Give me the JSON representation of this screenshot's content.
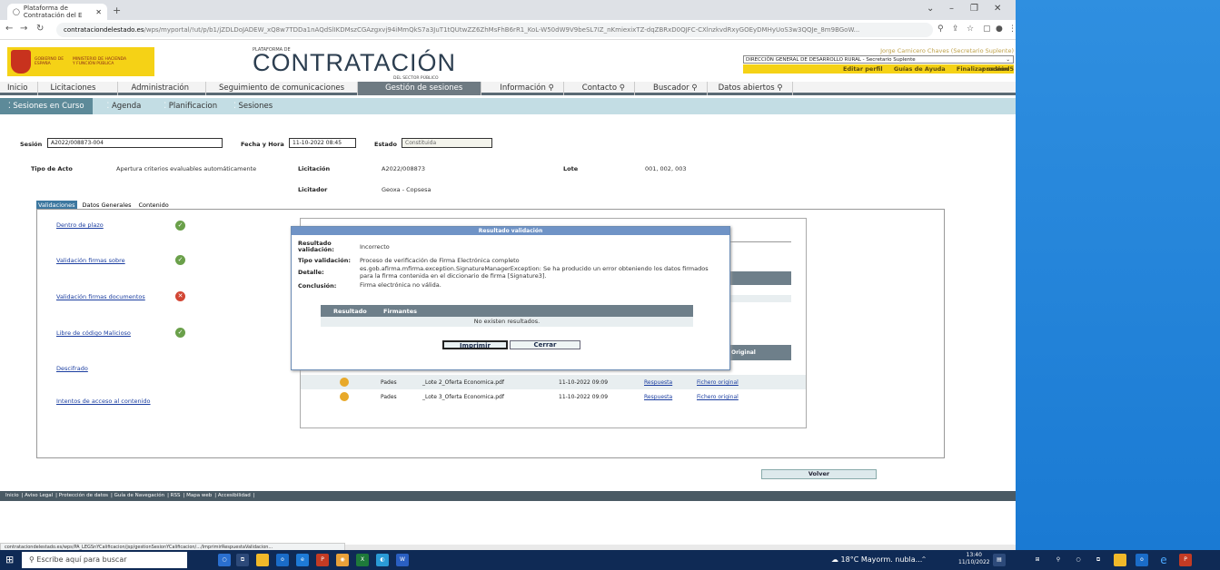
{
  "browser": {
    "tab_title": "Plataforma de Contratación del E",
    "url_host": "contrataciondelestado.es",
    "url_path": "/wps/myportal/!ut/p/b1/jZDLDoJADEW_xQ8w7TDDa1nAQdSlIKDMszCGAzgxvj94iMmQkS7a3JuT1tQUtwZZ6ZhMsFhB6rR1_KoL-W50dW9V9beSL7IZ_nKmiexixTZ-dqZBRxD0QJFC-CXlnzkvdRxyGOEyDMHyUoS3w3QQJe_8m9BGoW..."
  },
  "site": {
    "gov_lines": [
      "GOBIERNO DE ESPAÑA",
      "MINISTERIO DE HACIENDA Y FUNCIÓN PÚBLICA"
    ],
    "brand_top": "PLATAFORMA DE",
    "brand_main": "CONTRATACIÓN",
    "brand_sub": "DEL SECTOR PÚBLICO",
    "user_name": "Jorge Carnicero Chaves (Secretario Suplente)",
    "user_dir": "DIRECCIÓN GENERAL DE DESARROLLO RURAL - Secretario Suplente",
    "links": [
      "Editar perfil",
      "Guías de Ayuda",
      "Finalizar sesión"
    ],
    "env": "prodnod5"
  },
  "nav": [
    "Inicio",
    "Licitaciones",
    "Administración",
    "Seguimiento de comunicaciones",
    "Gestión de sesiones",
    "Información",
    "Contacto",
    "Buscador",
    "Datos abiertos"
  ],
  "subnav": [
    "Sesiones en Curso",
    "Agenda",
    "Planificacion",
    "Sesiones"
  ],
  "session": {
    "sesion_label": "Sesión",
    "sesion_val": "A2022/008873-004",
    "fecha_label": "Fecha y Hora",
    "fecha_val": "11-10-2022 08:45",
    "estado_label": "Estado",
    "estado_val": "Constituida",
    "acto_label": "Tipo de Acto",
    "acto_val": "Apertura criterios evaluables automáticamente",
    "licitacion_label": "Licitación",
    "licitacion_val": "A2022/008873",
    "lote_label": "Lote",
    "lote_val": "001, 002, 003",
    "licitador_label": "Licitador",
    "licitador_val": "Geoxa - Copsesa"
  },
  "tabs": [
    "Validaciones",
    "Datos Generales",
    "Contenido"
  ],
  "validations": [
    {
      "label": "Dentro de plazo",
      "status": "ok"
    },
    {
      "label": "Validación firmas sobre",
      "status": "ok"
    },
    {
      "label": "Validación firmas documentos",
      "status": "error"
    },
    {
      "label": "Libre de código Malicioso",
      "status": "ok"
    },
    {
      "label": "Descifrado",
      "status": "none"
    },
    {
      "label": "Intentos de acceso al contenido",
      "status": "none"
    }
  ],
  "inner": {
    "col_original": "Original",
    "rows": [
      {
        "tipo": "Pades",
        "fichero": "_Lote 2_Oferta Economica.pdf",
        "fecha": "11-10-2022 09:09",
        "resp": "Respuesta",
        "orig": "Fichero original"
      },
      {
        "tipo": "Pades",
        "fichero": "_Lote 3_Oferta Economica.pdf",
        "fecha": "11-10-2022 09:09",
        "resp": "Respuesta",
        "orig": "Fichero original"
      }
    ]
  },
  "modal": {
    "title": "Resultado validación",
    "resultado_label": "Resultado validación:",
    "resultado_val": "Incorrecto",
    "tipo_label": "Tipo validación:",
    "tipo_val": "Proceso de verificación de Firma Electrónica completo",
    "detalle_label": "Detalle:",
    "detalle_val": "es.gob.afirma.mfirma.exception.SignatureManagerException: Se ha producido un error obteniendo los datos firmados para la firma contenida en el diccionario de firma [Signature3].",
    "conclusion_label": "Conclusión:",
    "conclusion_val": "Firma electrónica no válida.",
    "col_resultado": "Resultado",
    "col_firmantes": "Firmantes",
    "empty": "No existen resultados.",
    "btn_print": "Imprimir",
    "btn_close": "Cerrar"
  },
  "volver": "Volver",
  "footer": [
    "Inicio",
    "Aviso Legal",
    "Protección de datos",
    "Guía de Navegación",
    "RSS",
    "Mapa web",
    "Accesibilidad"
  ],
  "status_url": "contrataciondelestado.es/wps/PA_LEGSnYCalificacion/jsp/gestionSesionYCalificacion/.../ImprimirRespuestaValidacion...",
  "taskbar": {
    "search_placeholder": "Escribe aquí para buscar",
    "weather": "18°C  Mayorm. nubla...",
    "time": "13:40",
    "date": "11/10/2022"
  }
}
